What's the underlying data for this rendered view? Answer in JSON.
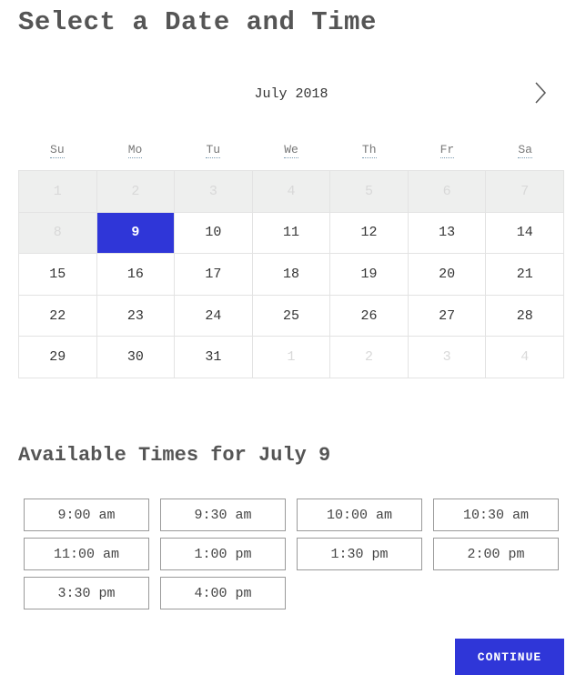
{
  "title": "Select a Date and Time",
  "calendar": {
    "month_label": "July 2018",
    "next_icon": "chevron-right-icon",
    "weekdays": [
      "Su",
      "Mo",
      "Tu",
      "We",
      "Th",
      "Fr",
      "Sa"
    ],
    "weeks": [
      [
        {
          "day": "1",
          "state": "past"
        },
        {
          "day": "2",
          "state": "past"
        },
        {
          "day": "3",
          "state": "past"
        },
        {
          "day": "4",
          "state": "past"
        },
        {
          "day": "5",
          "state": "past"
        },
        {
          "day": "6",
          "state": "past"
        },
        {
          "day": "7",
          "state": "past"
        }
      ],
      [
        {
          "day": "8",
          "state": "past"
        },
        {
          "day": "9",
          "state": "selected"
        },
        {
          "day": "10",
          "state": "active"
        },
        {
          "day": "11",
          "state": "active"
        },
        {
          "day": "12",
          "state": "active"
        },
        {
          "day": "13",
          "state": "active"
        },
        {
          "day": "14",
          "state": "active"
        }
      ],
      [
        {
          "day": "15",
          "state": "active"
        },
        {
          "day": "16",
          "state": "active"
        },
        {
          "day": "17",
          "state": "active"
        },
        {
          "day": "18",
          "state": "active"
        },
        {
          "day": "19",
          "state": "active"
        },
        {
          "day": "20",
          "state": "active"
        },
        {
          "day": "21",
          "state": "active"
        }
      ],
      [
        {
          "day": "22",
          "state": "active"
        },
        {
          "day": "23",
          "state": "active"
        },
        {
          "day": "24",
          "state": "active"
        },
        {
          "day": "25",
          "state": "active"
        },
        {
          "day": "26",
          "state": "active"
        },
        {
          "day": "27",
          "state": "active"
        },
        {
          "day": "28",
          "state": "active"
        }
      ],
      [
        {
          "day": "29",
          "state": "active"
        },
        {
          "day": "30",
          "state": "active"
        },
        {
          "day": "31",
          "state": "active"
        },
        {
          "day": "1",
          "state": "other-month"
        },
        {
          "day": "2",
          "state": "other-month"
        },
        {
          "day": "3",
          "state": "other-month"
        },
        {
          "day": "4",
          "state": "other-month"
        }
      ]
    ]
  },
  "times": {
    "title": "Available Times for July 9",
    "slots": [
      "9:00 am",
      "9:30 am",
      "10:00 am",
      "10:30 am",
      "11:00 am",
      "1:00 pm",
      "1:30 pm",
      "2:00 pm",
      "3:30 pm",
      "4:00 pm"
    ]
  },
  "continue_label": "CONTINUE",
  "colors": {
    "accent": "#2f36d8",
    "past_background": "#eeefee",
    "border": "#e3e3e3"
  }
}
